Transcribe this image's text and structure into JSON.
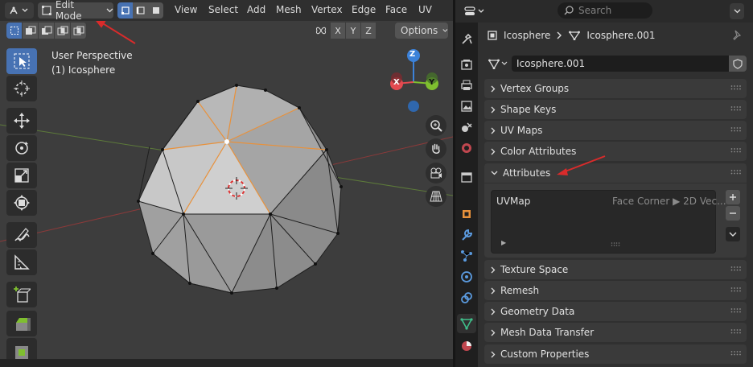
{
  "viewport": {
    "mode": "Edit Mode",
    "menus": [
      "View",
      "Select",
      "Add",
      "Mesh",
      "Vertex",
      "Edge",
      "Face",
      "UV"
    ],
    "mirror_axes": [
      "X",
      "Y",
      "Z"
    ],
    "options_label": "Options",
    "overlay_line1": "User Perspective",
    "overlay_line2": "(1) Icosphere",
    "gizmo_axes": [
      "X",
      "Y",
      "Z"
    ],
    "axis_colors": {
      "x": "#e34a50",
      "y": "#7fbf2f",
      "z": "#3c82d9"
    }
  },
  "properties": {
    "search_placeholder": "Search",
    "object_name": "Icosphere",
    "mesh_name": "Icosphere.001",
    "datablock_name": "Icosphere.001",
    "panels": [
      {
        "label": "Vertex Groups",
        "open": false
      },
      {
        "label": "Shape Keys",
        "open": false
      },
      {
        "label": "UV Maps",
        "open": false
      },
      {
        "label": "Color Attributes",
        "open": false
      },
      {
        "label": "Attributes",
        "open": true
      },
      {
        "label": "Texture Space",
        "open": false
      },
      {
        "label": "Remesh",
        "open": false
      },
      {
        "label": "Geometry Data",
        "open": false
      },
      {
        "label": "Mesh Data Transfer",
        "open": false
      },
      {
        "label": "Custom Properties",
        "open": false
      }
    ],
    "attribute_rows": [
      {
        "name": "UVMap",
        "domain": "Face Corner ▶ 2D Vec..."
      }
    ],
    "accent_color": "#4772b3"
  },
  "annotations": {
    "arrow_color": "#d92b2b"
  }
}
